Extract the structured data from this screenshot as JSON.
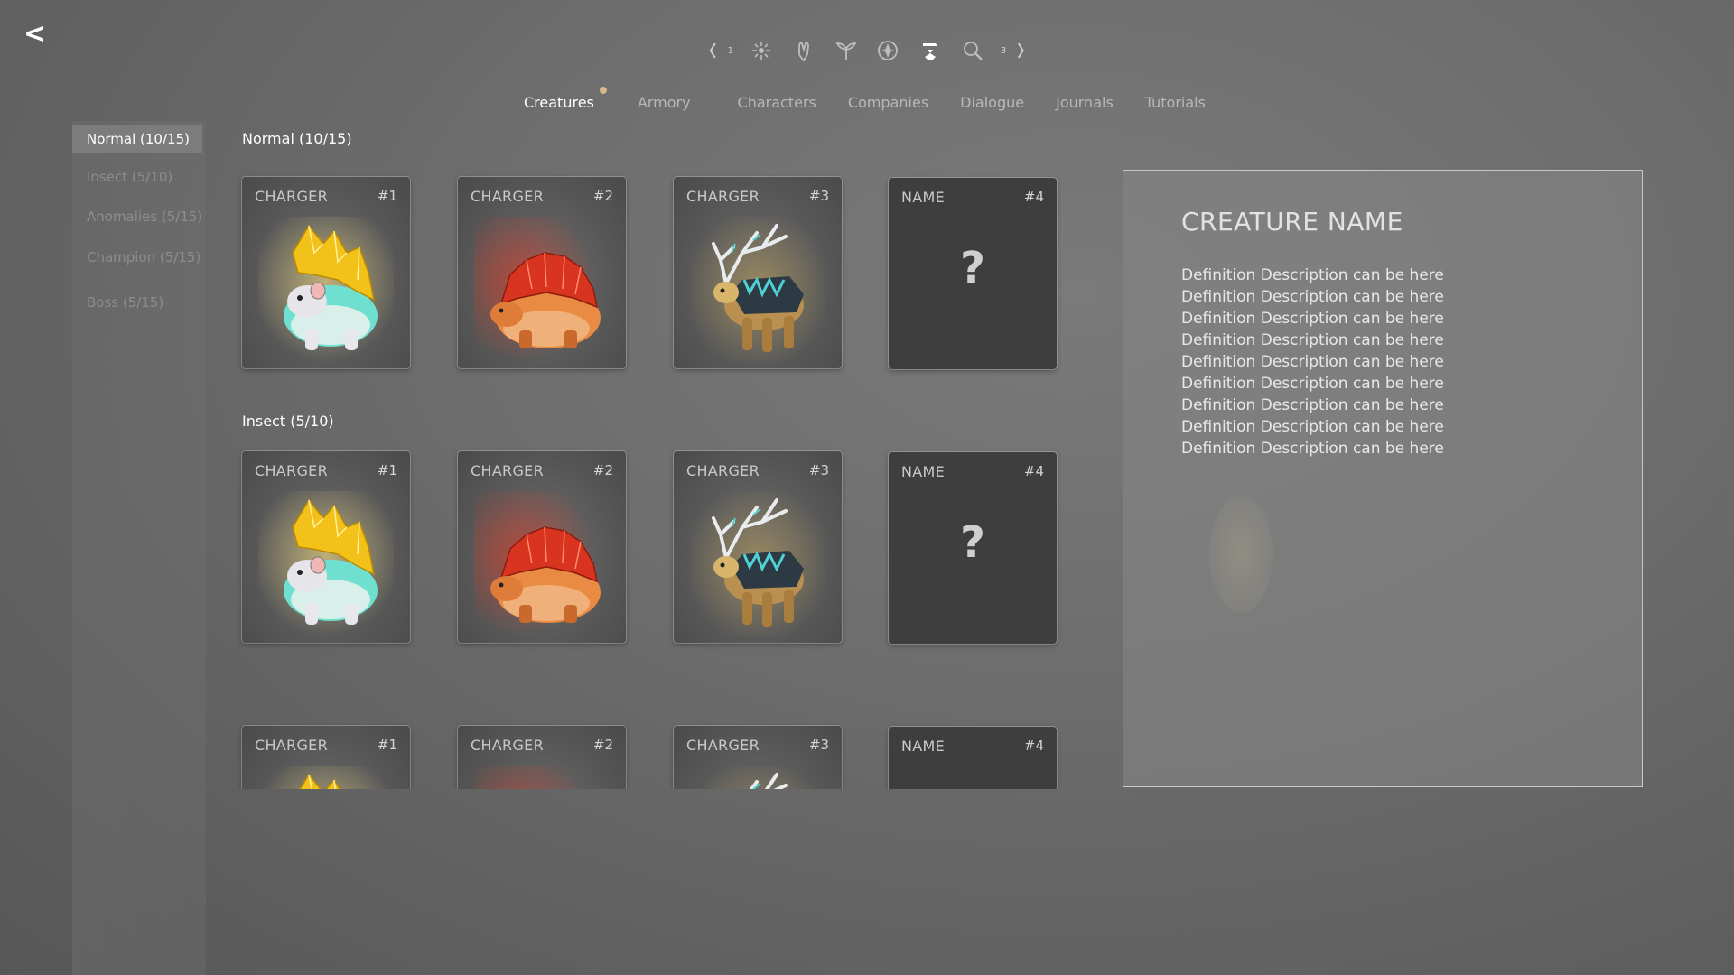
{
  "back": {
    "label": "<"
  },
  "icon_strip": {
    "prev_hint": "1",
    "next_hint": "3",
    "icons": [
      {
        "name": "sparkle-icon",
        "active": false
      },
      {
        "name": "hand-icon",
        "active": false
      },
      {
        "name": "sprout-icon",
        "active": false
      },
      {
        "name": "compass-icon",
        "active": false
      },
      {
        "name": "anvil-icon",
        "active": true
      },
      {
        "name": "magnifier-icon",
        "active": false
      }
    ]
  },
  "tabs": [
    {
      "label": "Creatures",
      "active": true,
      "has_notification": true
    },
    {
      "label": "Armory",
      "active": false
    },
    {
      "label": "Characters",
      "active": false
    },
    {
      "label": "Companies",
      "active": false
    },
    {
      "label": "Dialogue",
      "active": false
    },
    {
      "label": "Journals",
      "active": false
    },
    {
      "label": "Tutorials",
      "active": false
    }
  ],
  "sidebar": {
    "items": [
      {
        "label": "Normal (10/15)",
        "active": true
      },
      {
        "label": "Insect (5/10)",
        "active": false
      },
      {
        "label": "Anomalies (5/15)",
        "active": false
      },
      {
        "label": "Champion  (5/15)",
        "active": false
      },
      {
        "label": "Boss  (5/15)",
        "active": false
      }
    ]
  },
  "sections": [
    {
      "heading": "Normal (10/15)",
      "cards": [
        {
          "name": "CHARGER",
          "number": "#1",
          "locked": false,
          "creature": "gold-crystal-beast"
        },
        {
          "name": "CHARGER",
          "number": "#2",
          "locked": false,
          "creature": "red-crystal-beast"
        },
        {
          "name": "CHARGER",
          "number": "#3",
          "locked": false,
          "creature": "antlered-beast"
        },
        {
          "name": "NAME",
          "number": "#4",
          "locked": true,
          "placeholder": "?"
        }
      ]
    },
    {
      "heading": "Insect (5/10)",
      "cards": [
        {
          "name": "CHARGER",
          "number": "#1",
          "locked": false,
          "creature": "gold-crystal-beast"
        },
        {
          "name": "CHARGER",
          "number": "#2",
          "locked": false,
          "creature": "red-crystal-beast"
        },
        {
          "name": "CHARGER",
          "number": "#3",
          "locked": false,
          "creature": "antlered-beast"
        },
        {
          "name": "NAME",
          "number": "#4",
          "locked": true,
          "placeholder": "?"
        }
      ]
    },
    {
      "heading": "",
      "cards": [
        {
          "name": "CHARGER",
          "number": "#1",
          "locked": false,
          "creature": "gold-crystal-beast"
        },
        {
          "name": "CHARGER",
          "number": "#2",
          "locked": false,
          "creature": "red-crystal-beast"
        },
        {
          "name": "CHARGER",
          "number": "#3",
          "locked": false,
          "creature": "antlered-beast"
        },
        {
          "name": "NAME",
          "number": "#4",
          "locked": true,
          "placeholder": "?"
        }
      ]
    }
  ],
  "detail": {
    "title": "CREATURE NAME",
    "lines": [
      "Definition Description can be here",
      "Definition Description can be here",
      "Definition Description can be here",
      "Definition Description can be here",
      "Definition Description can be here",
      "Definition Description can be here",
      "Definition Description can be here",
      "Definition Description can be here",
      "Definition Description can be here"
    ]
  },
  "colors": {
    "notification_dot": "#d9b98a",
    "gold_crystal": "#f2c21a",
    "red_crystal": "#d8341f",
    "cyan_accent": "#4fd2d6"
  }
}
